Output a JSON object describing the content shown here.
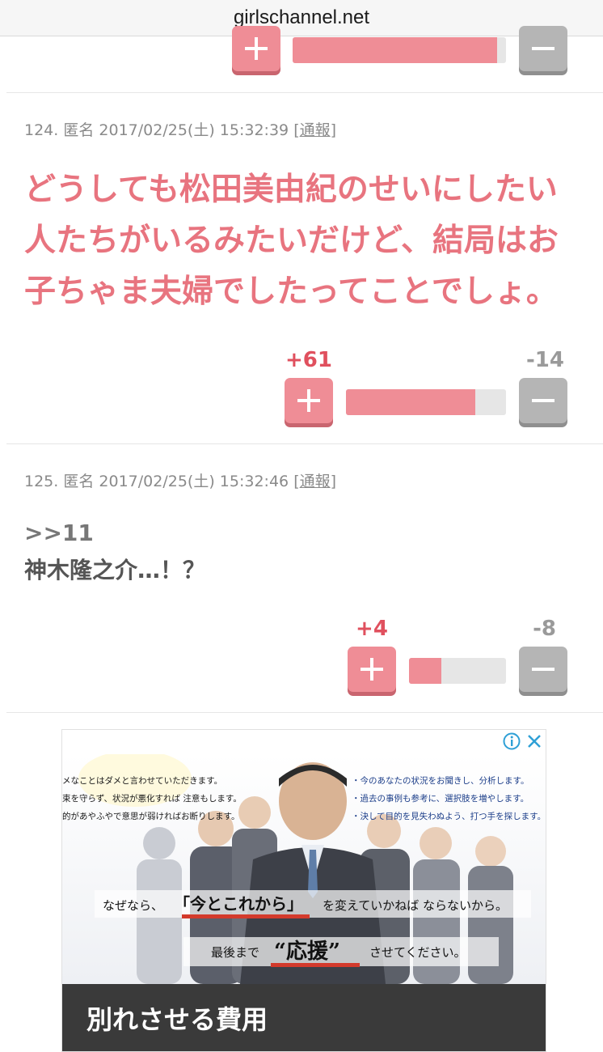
{
  "browser": {
    "url": "girlschannel.net"
  },
  "comments": [
    {
      "partial": true,
      "fill_fraction": 0.96
    },
    {
      "number": "124.",
      "author": "匿名",
      "datetime": "2017/02/25(土) 15:32:39",
      "report_label": "通報",
      "report_open": "[",
      "report_close": "]",
      "body_lines": [
        "どうしても松田美由紀のせいにしたい",
        "人たちがいるみたいだけど、結局はお",
        "子ちゃま夫婦でしたってことでしょ。"
      ],
      "plus_count": "+61",
      "minus_count": "-14",
      "fill_fraction": 0.81
    },
    {
      "number": "125.",
      "author": "匿名",
      "datetime": "2017/02/25(土) 15:32:46",
      "report_label": "通報",
      "report_open": "[",
      "report_close": "]",
      "quote": ">>11",
      "body": "神木隆之介…！？",
      "plus_count": "+4",
      "minus_count": "-8",
      "fill_fraction": 0.33
    }
  ],
  "ad": {
    "bullets_right": [
      "・今のあなたの状況をお聞きし、分析します。",
      "・過去の事例も参考に、選択肢を増やします。",
      "・決して目的を見失わぬよう、打つ手を探します。"
    ],
    "bullets_left": [
      "メなことはダメと言わせていただきます。",
      "束を守らず、状況が悪化すれば 注意もします。",
      "的があやふやで意思が弱ければお断りします。"
    ],
    "line1_pre": "なぜなら、",
    "line1_key": "「今とこれから」",
    "line1_post": "を変えていかねば ならないから。",
    "line2_pre": "最後まで",
    "line2_key": "“応援”",
    "line2_post": "させてください。",
    "caption": "別れさせる費用",
    "colors": {
      "underline": "#d33a2c",
      "caption_bg": "#3a3a3a"
    }
  }
}
